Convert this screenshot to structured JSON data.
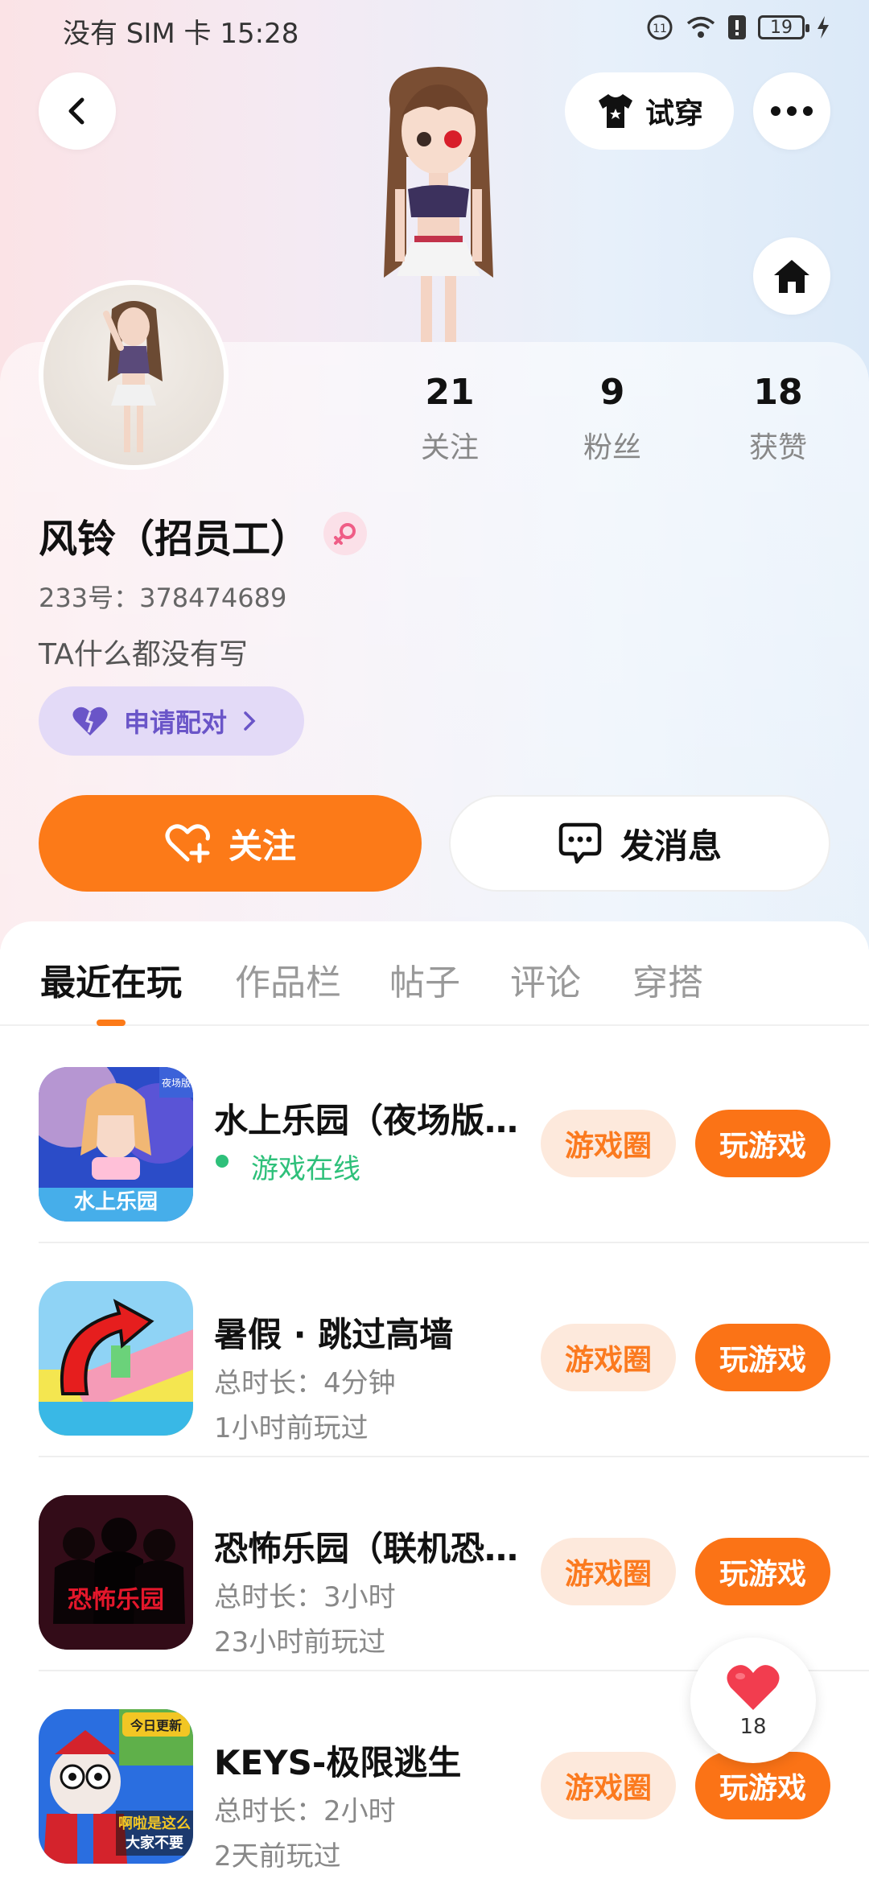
{
  "status": {
    "carrier_time": "没有 SIM 卡 15:28",
    "battery": "19"
  },
  "top": {
    "tryon_label": "试穿"
  },
  "profile": {
    "name": "风铃（招员工）",
    "uid": "233号：378474689",
    "bio": "TA什么都没有写",
    "pair_label": "申请配对",
    "stats": [
      {
        "num": "21",
        "label": "关注"
      },
      {
        "num": "9",
        "label": "粉丝"
      },
      {
        "num": "18",
        "label": "获赞"
      }
    ],
    "follow_label": "关注",
    "message_label": "发消息"
  },
  "tabs": [
    "最近在玩",
    "作品栏",
    "帖子",
    "评论",
    "穿搭"
  ],
  "games": [
    {
      "title": "水上乐园（夜场版…",
      "line1": "游戏在线",
      "line2": "",
      "online": true,
      "circle": "游戏圈",
      "play": "玩游戏",
      "icon_text": "水上乐园",
      "badge": "夜场版"
    },
    {
      "title": "暑假 · 跳过高墙",
      "line1": "总时长：4分钟",
      "line2": "1小时前玩过",
      "online": false,
      "circle": "游戏圈",
      "play": "玩游戏"
    },
    {
      "title": "恐怖乐园（联机恐…",
      "line1": "总时长：3小时",
      "line2": "23小时前玩过",
      "online": false,
      "circle": "游戏圈",
      "play": "玩游戏",
      "icon_text": "恐怖乐园"
    },
    {
      "title": "KEYS-极限逃生",
      "line1": "总时长：2小时",
      "line2": "2天前玩过",
      "online": false,
      "circle": "游戏圈",
      "play": "玩游戏",
      "badge": "今日更新",
      "icon_text": "啊啦是这么大家不要"
    }
  ],
  "like": {
    "count": "18"
  },
  "colors": {
    "accent": "#fc7a18",
    "online": "#2ec07a",
    "pair": "#6a55c8"
  }
}
